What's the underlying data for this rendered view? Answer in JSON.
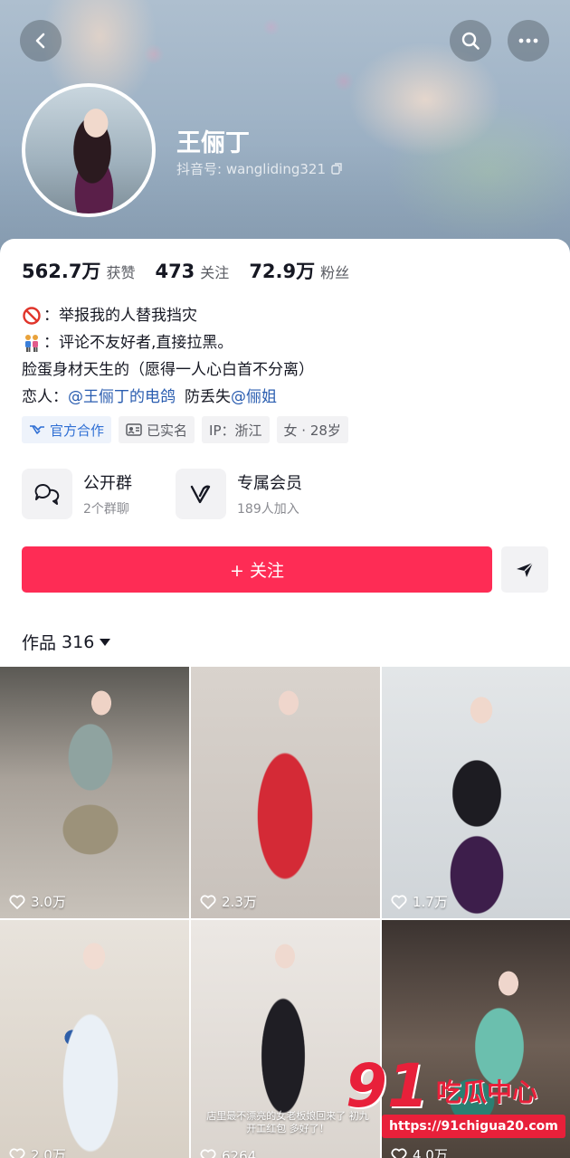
{
  "profile": {
    "name": "王俪丁",
    "handle_label": "抖音号: wangliding321"
  },
  "stats": [
    {
      "value": "562.7万",
      "label": "获赞"
    },
    {
      "value": "473",
      "label": "关注"
    },
    {
      "value": "72.9万",
      "label": "粉丝"
    }
  ],
  "bio": {
    "line1": "：举报我的人替我挡灾",
    "line2": "：评论不友好者,直接拉黑。",
    "line3": "脸蛋身材天生的（愿得一人心白首不分离）",
    "line4_prefix": "恋人：",
    "line4_link1": "@王俪丁的电鸽",
    "line4_mid": "防丢失",
    "line4_link2": "@俪姐"
  },
  "tags": [
    "官方合作",
    "已实名",
    "IP：浙江",
    "女 · 28岁"
  ],
  "features": [
    {
      "title": "公开群",
      "sub": "2个群聊",
      "icon": "chat-group-icon"
    },
    {
      "title": "专属会员",
      "sub": "189人加入",
      "icon": "vip-icon"
    }
  ],
  "follow_label": "+ 关注",
  "works": {
    "label": "作品",
    "count": "316"
  },
  "videos": [
    {
      "likes": "3.0万"
    },
    {
      "likes": "2.3万"
    },
    {
      "likes": "1.7万"
    },
    {
      "likes": "2.0万"
    },
    {
      "likes": "6264",
      "caption": "店里最不漂亮的女老板娘回来了 初九开工红包 多好了！"
    },
    {
      "likes": "4.0万"
    }
  ],
  "watermark": {
    "big": "91",
    "text": "吃瓜中心",
    "url": "https://91chigua20.com"
  },
  "colors": {
    "accent": "#fe2c55",
    "link": "#2a5db0",
    "watermark": "#e8203a"
  }
}
